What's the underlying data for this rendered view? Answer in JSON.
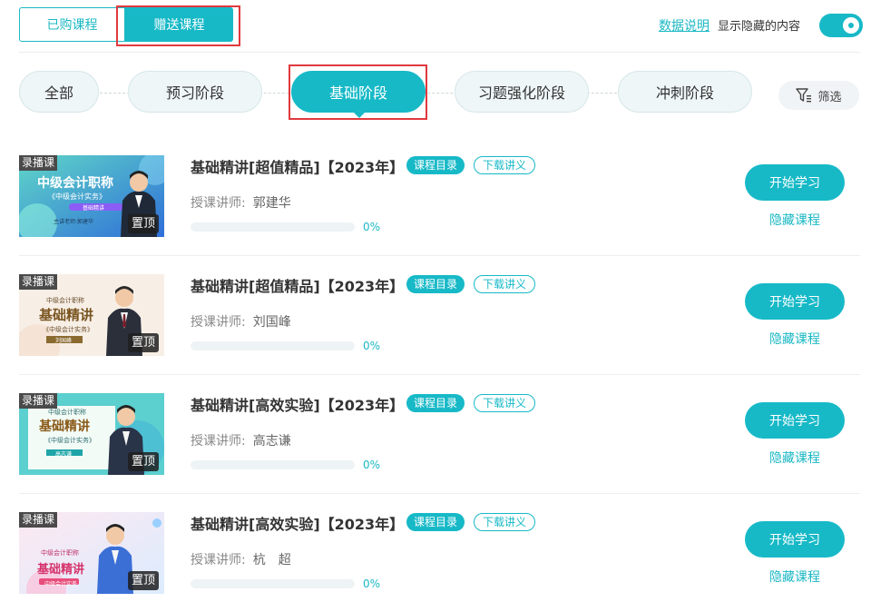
{
  "tabs": {
    "purchased": "已购课程",
    "gift": "赠送课程"
  },
  "header": {
    "data_link": "数据说明",
    "show_hidden": "显示隐藏的内容",
    "toggle_on": true
  },
  "stages": [
    "全部",
    "预习阶段",
    "基础阶段",
    "习题强化阶段",
    "冲刺阶段"
  ],
  "active_stage": "基础阶段",
  "filter_label": "筛选",
  "colors": {
    "accent": "#17b9c7",
    "highlight_box": "#e0393e"
  },
  "course_labels": {
    "record_badge": "录播课",
    "pin_badge": "置顶",
    "catalog_tag": "课程目录",
    "download_tag": "下载讲义",
    "teacher_label": "授课讲师:",
    "start_button": "开始学习",
    "hide_link": "隐藏课程"
  },
  "courses": [
    {
      "title": "基础精讲[超值精品]【2023年】",
      "teacher": "郭建华",
      "progress_text": "0%",
      "progress": 0,
      "thumb": {
        "line1": "中级会计职称",
        "line2": "《中级会计实务》",
        "line3": "基础精讲",
        "line4": "主讲老师:郭建华"
      }
    },
    {
      "title": "基础精讲[超值精品]【2023年】",
      "teacher": "刘国峰",
      "progress_text": "0%",
      "progress": 0,
      "thumb": {
        "line1": "中级会计职称",
        "line2": "基础精讲",
        "line3": "《中级会计实务》",
        "line4": "刘国峰"
      }
    },
    {
      "title": "基础精讲[高效实验]【2023年】",
      "teacher": "高志谦",
      "progress_text": "0%",
      "progress": 0,
      "thumb": {
        "line1": "中级会计职称",
        "line2": "基础精讲",
        "line3": "《中级会计实务》",
        "line4": "高志谦"
      }
    },
    {
      "title": "基础精讲[高效实验]【2023年】",
      "teacher": "杭　超",
      "progress_text": "0%",
      "progress": 0,
      "thumb": {
        "line1": "中级会计职称",
        "line2": "基础精讲",
        "line3": "中级会计实务",
        "line4": ""
      }
    }
  ]
}
